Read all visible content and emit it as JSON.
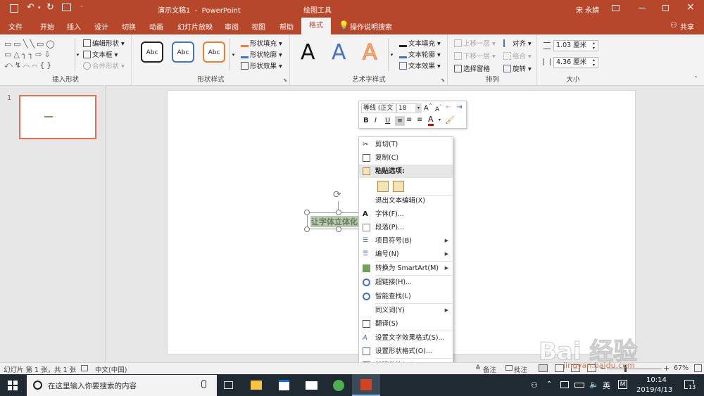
{
  "titlebar": {
    "doc_title": "演示文稿1  -  PowerPoint",
    "tools_tab": "绘图工具",
    "user": "宋 永婧"
  },
  "tabs": [
    "文件",
    "开始",
    "插入",
    "设计",
    "切换",
    "动画",
    "幻灯片放映",
    "审阅",
    "视图",
    "帮助",
    "格式"
  ],
  "search_tab": "操作说明搜索",
  "share": "共享",
  "ribbon": {
    "insert_shapes": {
      "label": "插入形状",
      "edit_shape": "编辑形状",
      "text_box": "文本框",
      "merge_shapes": "合并形状"
    },
    "shape_styles": {
      "label": "形状样式",
      "sample": "Abc",
      "fill": "形状填充",
      "outline": "形状轮廓",
      "effects": "形状效果"
    },
    "wordart": {
      "label": "艺术字样式",
      "letter": "A",
      "text_fill": "文本填充",
      "text_outline": "文本轮廓",
      "text_effects": "文本效果"
    },
    "arrange": {
      "label": "排列",
      "bring_forward": "上移一层",
      "send_backward": "下移一层",
      "selection_pane": "选择窗格",
      "align": "对齐",
      "group": "组合",
      "rotate": "旋转"
    },
    "size": {
      "label": "大小",
      "height": "1.03 厘米",
      "width": "4.36 厘米"
    }
  },
  "slide_panel": {
    "number": "1"
  },
  "textbox_text": "让字体立体化",
  "mini_toolbar": {
    "font": "等线 (正文",
    "size": "18",
    "bold": "B",
    "italic": "I",
    "underline": "U",
    "font_color_letter": "A"
  },
  "context_menu": {
    "items": [
      "剪切(T)",
      "复制(C)",
      "粘贴选项:",
      "退出文本编辑(X)",
      "字体(F)...",
      "段落(P)...",
      "项目符号(B)",
      "编号(N)",
      "转换为 SmartArt(M)",
      "超链接(H)...",
      "智能查找(L)",
      "同义词(Y)",
      "翻译(S)",
      "设置文字效果格式(S)...",
      "设置形状格式(O)...",
      "新建批注(M)"
    ]
  },
  "statusbar": {
    "slide_info": "幻灯片 第 1 张，共 1 张",
    "language": "中文(中国)",
    "notes": "备注",
    "comments": "批注",
    "zoom": "67%"
  },
  "taskbar": {
    "search_placeholder": "在这里输入你要搜索的内容",
    "ime": "英",
    "time": "10:14",
    "date": "2019/4/13",
    "notification_count": "13"
  },
  "watermark": {
    "brand": "Bai 经验",
    "url": "jingyan.baidu.com"
  },
  "colors": {
    "accent": "#b7472a",
    "taskbar": "#1f2a33",
    "textbox_fill": "#b6c9ad",
    "textbox_text": "#7b8a72"
  }
}
